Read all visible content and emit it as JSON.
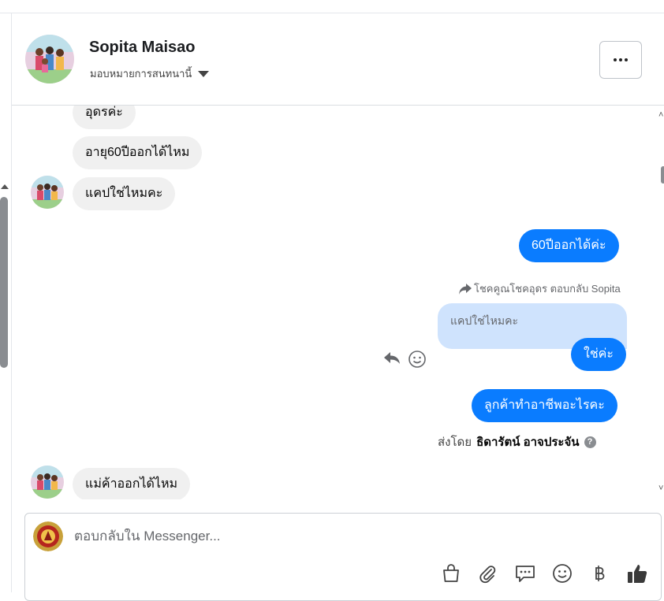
{
  "contact": {
    "name": "Sopita Maisao",
    "assign_label": "มอบหมายการสนทนานี้"
  },
  "messages": {
    "m1": "อุดรค่ะ",
    "m2": "อายุ60ปีออกได้ไหม",
    "m3": "แคปใช่ไหมคะ",
    "m4": "60ปีออกได้ค่ะ",
    "reply_note": "โชคคูณโชคอุดร ตอบกลับ Sopita",
    "quoted": "แคปใช่ไหมคะ",
    "m5": "ใช่ค่ะ",
    "m6": "ลูกค้าทำอาชีพอะไรคะ",
    "sent_by_prefix": "ส่งโดย",
    "sent_by_name": "ธิดารัตน์ อาจประจัน",
    "m7": "แม่ค้าออกได้ไหม"
  },
  "composer": {
    "placeholder": "ตอบกลับใน Messenger..."
  },
  "colors": {
    "outgoing": "#0a7cff",
    "incoming": "#f0f0f0",
    "quote": "#cfe3fd"
  }
}
